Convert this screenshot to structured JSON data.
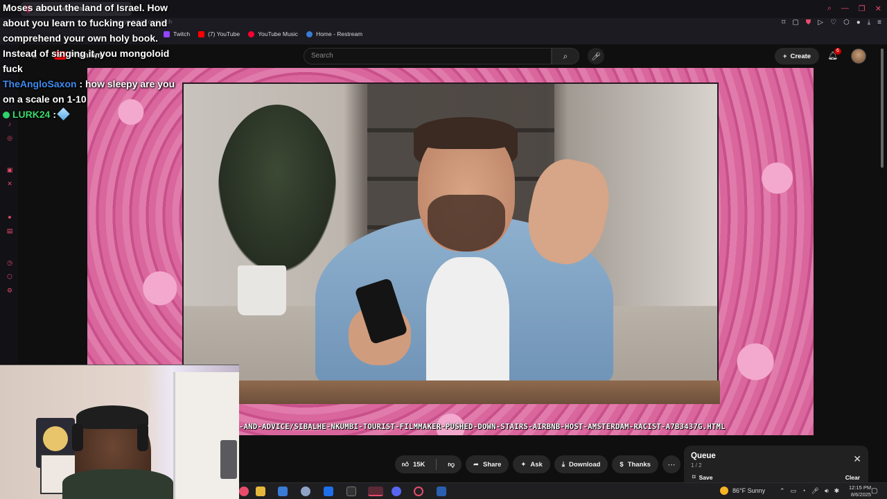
{
  "browser": {
    "tab_title": "(6) The Dangers of A",
    "address": "www.youtube.com/watch",
    "bookmarks": [
      {
        "label": "Twitch",
        "color": "#9146ff"
      },
      {
        "label": "(7) YouTube",
        "color": "#ff0000"
      },
      {
        "label": "YouTube Music",
        "color": "#ff0033"
      },
      {
        "label": "Home - Restream",
        "color": "#3a7bd5"
      }
    ],
    "accent_color": "#e74c6b"
  },
  "youtube": {
    "logo_label": "Premium",
    "search_placeholder": "Search",
    "create_label": "Create",
    "notification_count": "6"
  },
  "video": {
    "ticker_url": "-AND-ADVICE/SIBALHE-NKUMBI-TOURIST-FILMMAKER-PUSHED-DOWN-STAIRS-AIRBNB-HOST-AMSTERDAM-RACIST-A7B3437G.HTML"
  },
  "chat": {
    "messages": [
      {
        "text": "Moses about the land of Israel. How about you learn to fucking read and comprehend your own holy book. Instead of singing it, you mongoloid fuck"
      },
      {
        "user": "TheAngloSaxon",
        "text": ": how sleepy are you on a scale on 1-10"
      },
      {
        "user": "LURK24",
        "text": ":"
      }
    ]
  },
  "actions": {
    "like_count": "15K",
    "share_label": "Share",
    "ask_label": "Ask",
    "download_label": "Download",
    "thanks_label": "Thanks"
  },
  "queue": {
    "title": "Queue",
    "count": "1 / 2",
    "save_label": "Save",
    "clear_label": "Clear"
  },
  "taskbar": {
    "weather": "86°F  Sunny",
    "time": "12:15 PM",
    "date": "8/6/2025"
  }
}
